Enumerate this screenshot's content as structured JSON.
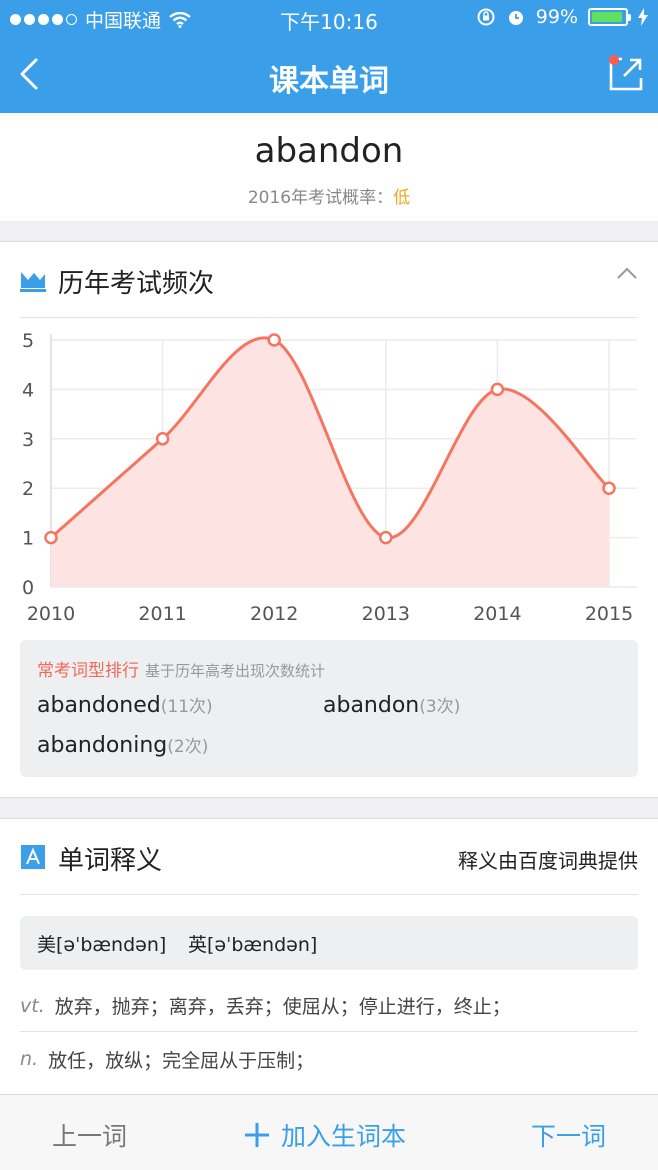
{
  "status": {
    "carrier": "中国联通",
    "time": "下午10:16",
    "battery": "99%"
  },
  "nav": {
    "title": "课本单词"
  },
  "word": {
    "text": "abandon",
    "prob_label": "2016年考试概率：",
    "prob_value": "低"
  },
  "history": {
    "title": "历年考试频次",
    "ranking_title": "常考词型排行",
    "ranking_sub": "基于历年高考出现次数统计",
    "forms": [
      {
        "word": "abandoned",
        "count": "(11次)"
      },
      {
        "word": "abandon",
        "count": "(3次)"
      },
      {
        "word": "abandoning",
        "count": "(2次)"
      }
    ]
  },
  "chart_data": {
    "type": "area",
    "x": [
      "2010",
      "2011",
      "2012",
      "2013",
      "2014",
      "2015"
    ],
    "y": [
      1,
      3,
      5,
      1,
      4,
      2
    ],
    "yticks": [
      "0",
      "1",
      "2",
      "3",
      "4",
      "5"
    ],
    "ylim": [
      0,
      5
    ],
    "grid": true,
    "colors": {
      "line": "#f57560",
      "fill": "#fde4e3"
    }
  },
  "definition": {
    "title": "单词释义",
    "source": "释义由百度词典提供",
    "us_phonetic": "美[əˈbændən]",
    "uk_phonetic": "英[əˈbændən]",
    "senses": [
      {
        "pos": "vt.",
        "text": "放弃，抛弃；离弃，丢弃；使屈从；停止进行，终止；"
      },
      {
        "pos": "n.",
        "text": "放任，放纵；完全屈从于压制；"
      }
    ]
  },
  "toolbar": {
    "prev": "上一词",
    "add": "加入生词本",
    "next": "下一词"
  },
  "colors": {
    "primary": "#3a9fe8",
    "accent": "#f57560",
    "warning": "#f5a623"
  }
}
